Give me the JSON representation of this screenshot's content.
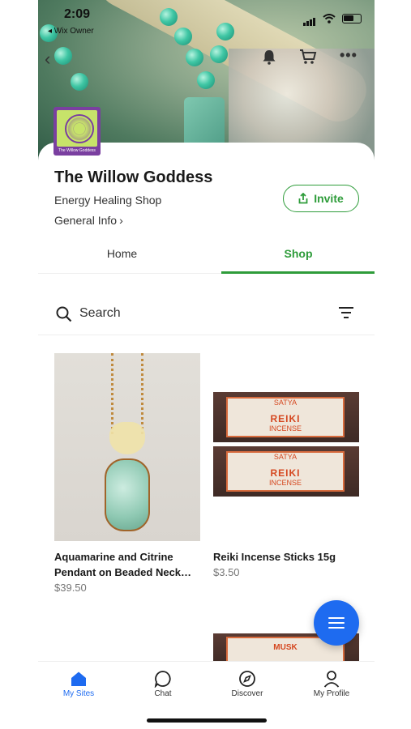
{
  "status_bar": {
    "time": "2:09",
    "back_app": "◂ Wix Owner"
  },
  "site": {
    "title": "The Willow Goddess",
    "subtitle": "Energy Healing Shop",
    "general_info": "General Info",
    "logo_caption": "The Willow Goddess",
    "invite_label": "Invite"
  },
  "tabs": [
    {
      "label": "Home",
      "active": false
    },
    {
      "label": "Shop",
      "active": true
    }
  ],
  "search": {
    "label": "Search"
  },
  "products": [
    {
      "name": "Aquamarine and Citrine Pendant on Beaded Neck…",
      "price": "$39.50"
    },
    {
      "name": "Reiki Incense Sticks 15g",
      "price": "$3.50"
    }
  ],
  "incense_box": {
    "brand": "SATYA",
    "name": "REIKI",
    "type": "INCENSE",
    "next_name": "MUSK"
  },
  "bottom_nav": [
    {
      "label": "My Sites",
      "icon": "home-icon",
      "active": true
    },
    {
      "label": "Chat",
      "icon": "chat-icon",
      "active": false
    },
    {
      "label": "Discover",
      "icon": "compass-icon",
      "active": false
    },
    {
      "label": "My Profile",
      "icon": "profile-icon",
      "active": false
    }
  ],
  "colors": {
    "accent_green": "#2e9c3a",
    "accent_blue": "#1e6bf0",
    "logo_purple": "#7a3fa0"
  }
}
